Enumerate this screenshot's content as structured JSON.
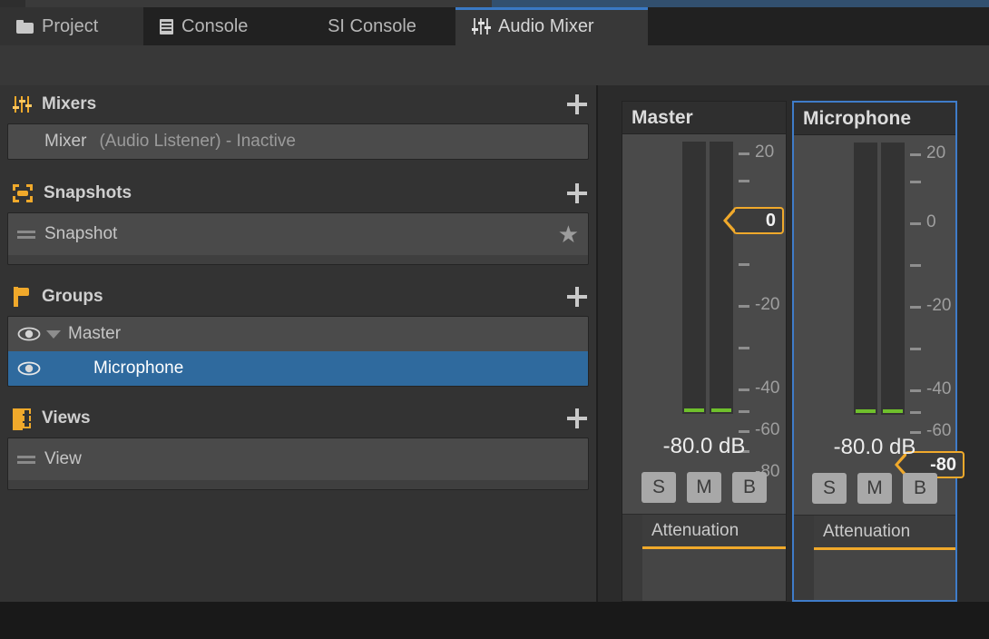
{
  "tabs": [
    {
      "label": "Project",
      "icon": "folder-icon",
      "state": "inactive"
    },
    {
      "label": "Console",
      "icon": "console-icon",
      "state": "plain"
    },
    {
      "label": "SI Console",
      "icon": "none",
      "state": "plain"
    },
    {
      "label": "Audio Mixer",
      "icon": "mixer-icon",
      "state": "active"
    }
  ],
  "colors": {
    "accent_orange": "#f0a92b",
    "selection_blue": "#2f6a9e",
    "tab_highlight_blue": "#3a79c4",
    "meter_green": "#6fc02c",
    "panel_bg": "#333333",
    "strip_bg": "#4a4a4a"
  },
  "sidebar": {
    "mixers": {
      "title": "Mixers",
      "add_label": "+",
      "items": [
        {
          "name": "Mixer",
          "status": "(Audio Listener) - Inactive"
        }
      ]
    },
    "snapshots": {
      "title": "Snapshots",
      "add_label": "+",
      "items": [
        {
          "name": "Snapshot",
          "starred": true
        }
      ]
    },
    "groups": {
      "title": "Groups",
      "add_label": "+",
      "items": [
        {
          "name": "Master",
          "expanded": true,
          "indent": 0,
          "selected": false,
          "visible": true
        },
        {
          "name": "Microphone",
          "expanded": false,
          "indent": 1,
          "selected": true,
          "visible": true
        }
      ]
    },
    "views": {
      "title": "Views",
      "add_label": "+",
      "items": [
        {
          "name": "View"
        }
      ]
    }
  },
  "strips": [
    {
      "name": "Master",
      "selected": false,
      "db_readout": "-80.0 dB",
      "fader_value": "0",
      "fader_db": 0,
      "meters": [
        {
          "level_db": -80
        },
        {
          "level_db": -80
        }
      ],
      "buttons": [
        {
          "label": "S",
          "name": "solo"
        },
        {
          "label": "M",
          "name": "mute"
        },
        {
          "label": "B",
          "name": "bypass"
        }
      ],
      "effects": [
        {
          "label": "Attenuation"
        }
      ]
    },
    {
      "name": "Microphone",
      "selected": true,
      "db_readout": "-80.0 dB",
      "fader_value": "-80",
      "fader_db": -80,
      "meters": [
        {
          "level_db": -80
        },
        {
          "level_db": -80
        }
      ],
      "buttons": [
        {
          "label": "S",
          "name": "solo"
        },
        {
          "label": "M",
          "name": "mute"
        },
        {
          "label": "B",
          "name": "bypass"
        }
      ],
      "effects": [
        {
          "label": "Attenuation"
        }
      ]
    }
  ],
  "scale": {
    "unit": "dB",
    "max": 20,
    "min": -80,
    "labeled_ticks": [
      20,
      0,
      -20,
      -40,
      -60,
      -80
    ],
    "minor_ticks": [
      10,
      -10,
      -30,
      -50,
      -70
    ]
  }
}
